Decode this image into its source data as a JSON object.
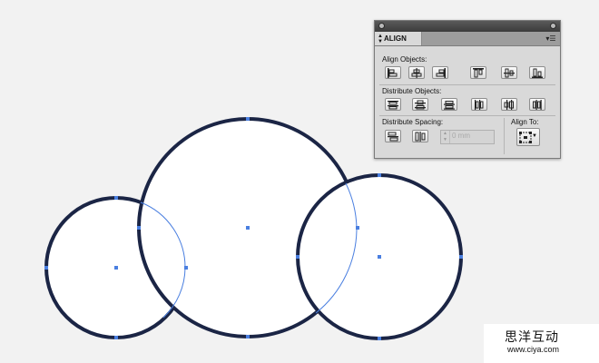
{
  "panel": {
    "tab_label": "ALIGN",
    "menu_icon": "panel-menu-icon",
    "align_objects_label": "Align Objects:",
    "distribute_objects_label": "Distribute Objects:",
    "distribute_spacing_label": "Distribute Spacing:",
    "align_to_label": "Align To:",
    "spacing_value": "0 mm",
    "align_objects_buttons": [
      "horizontal-align-left-icon",
      "horizontal-align-center-icon",
      "horizontal-align-right-icon",
      "vertical-align-top-icon",
      "vertical-align-center-icon",
      "vertical-align-bottom-icon"
    ],
    "distribute_objects_buttons": [
      "vertical-distribute-top-icon",
      "vertical-distribute-center-icon",
      "vertical-distribute-bottom-icon",
      "horizontal-distribute-left-icon",
      "horizontal-distribute-center-icon",
      "horizontal-distribute-right-icon"
    ],
    "distribute_spacing_buttons": [
      "vertical-distribute-space-icon",
      "horizontal-distribute-space-icon"
    ]
  },
  "colors": {
    "canvas": "#f2f2f2",
    "shape_stroke": "#1b2545",
    "selection_blue": "#4a7fe0",
    "panel_bg": "#d9d9d9"
  },
  "watermark": {
    "chinese_text": "思洋互动",
    "url": "www.ciya.com"
  }
}
